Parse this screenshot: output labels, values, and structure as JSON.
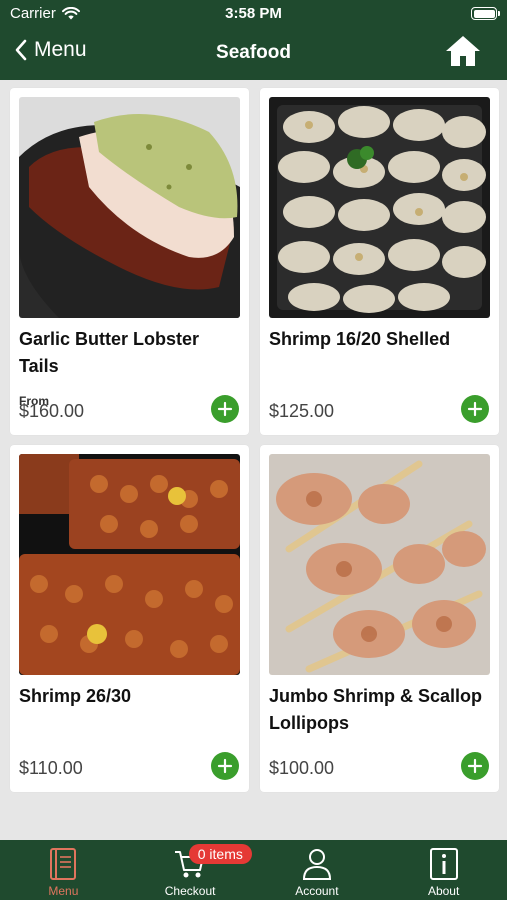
{
  "status_bar": {
    "carrier": "Carrier",
    "time": "3:58 PM"
  },
  "nav": {
    "back_label": "Menu",
    "title": "Seafood",
    "home_icon": "home-icon"
  },
  "products": [
    {
      "name": "Garlic Butter Lobster Tails",
      "from_label": "From",
      "price": "$160.00"
    },
    {
      "name": "Shrimp 16/20 Shelled",
      "price": "$125.00"
    },
    {
      "name": "Shrimp 26/30",
      "price": "$110.00"
    },
    {
      "name": "Jumbo Shrimp & Scallop Lollipops",
      "price": "$100.00"
    }
  ],
  "tabbar": {
    "menu": "Menu",
    "checkout": "Checkout",
    "cart_badge": "0 items",
    "account": "Account",
    "about": "About"
  },
  "colors": {
    "header": "#1f4a2e",
    "accent_active": "#e0755e",
    "add_button": "#3a9e2c",
    "badge": "#e53935"
  }
}
